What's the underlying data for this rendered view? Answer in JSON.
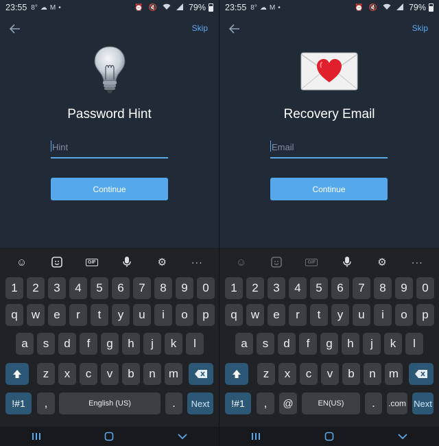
{
  "statusbar": {
    "time": "23:55",
    "battery": "79%"
  },
  "colors": {
    "background": "#212b37",
    "accent": "#55a8ea",
    "keyboard": "#202226",
    "key": "#3c3f44",
    "special_key": "#2c5876"
  },
  "left": {
    "skip": "Skip",
    "hero_icon": "lightbulb-icon",
    "title": "Password Hint",
    "field": {
      "value": "",
      "placeholder": "Hint"
    },
    "continue": "Continue",
    "keyboard": {
      "numbers": [
        "1",
        "2",
        "3",
        "4",
        "5",
        "6",
        "7",
        "8",
        "9",
        "0"
      ],
      "row1": [
        "q",
        "w",
        "e",
        "r",
        "t",
        "y",
        "u",
        "i",
        "o",
        "p"
      ],
      "row2": [
        "a",
        "s",
        "d",
        "f",
        "g",
        "h",
        "j",
        "k",
        "l"
      ],
      "row3": [
        "z",
        "x",
        "c",
        "v",
        "b",
        "n",
        "m"
      ],
      "symbols": "!#1",
      "comma": ",",
      "space": "English (US)",
      "period": ".",
      "next": "Next"
    }
  },
  "right": {
    "skip": "Skip",
    "hero_icon": "love-letter-icon",
    "title": "Recovery Email",
    "field": {
      "value": "",
      "placeholder": "Email"
    },
    "continue": "Continue",
    "keyboard": {
      "numbers": [
        "1",
        "2",
        "3",
        "4",
        "5",
        "6",
        "7",
        "8",
        "9",
        "0"
      ],
      "row1": [
        "q",
        "w",
        "e",
        "r",
        "t",
        "y",
        "u",
        "i",
        "o",
        "p"
      ],
      "row2": [
        "a",
        "s",
        "d",
        "f",
        "g",
        "h",
        "j",
        "k",
        "l"
      ],
      "row3": [
        "z",
        "x",
        "c",
        "v",
        "b",
        "n",
        "m"
      ],
      "symbols": "!#1",
      "comma": ",",
      "at": "@",
      "space": "EN(US)",
      "period": ".",
      "dotcom": ".com",
      "next": "Next"
    }
  }
}
